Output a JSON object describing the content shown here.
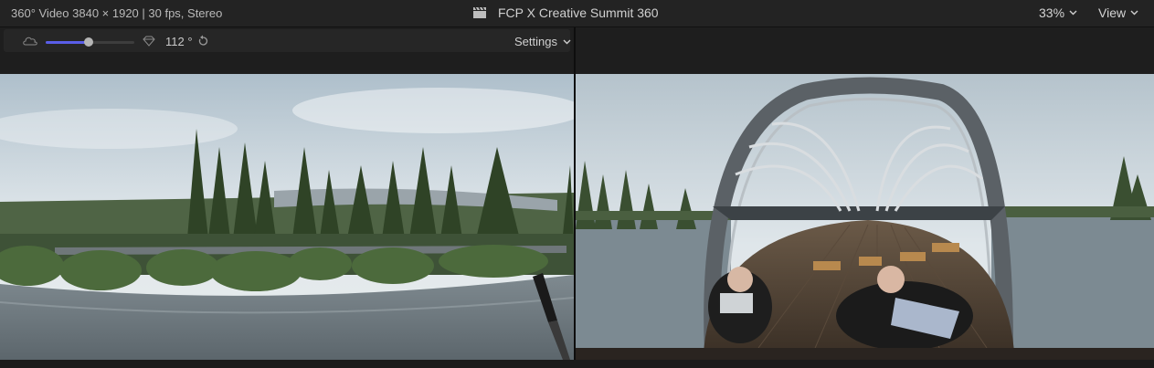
{
  "header": {
    "video_info": "360° Video 3840 × 1920 | 30 fps, Stereo",
    "project_title": "FCP X Creative Summit 360",
    "zoom_level": "33%",
    "view_label": "View"
  },
  "toolbar": {
    "angle_value": "112 °",
    "settings_label": "Settings",
    "slider_level": 0.48
  },
  "colors": {
    "accent": "#5a5ee8",
    "background": "#1b1b1b",
    "panel": "#232323"
  },
  "icons": {
    "title": "clapperboard-icon",
    "left_control": "cloud-icon",
    "right_control": "gem-icon",
    "reset": "reset-icon"
  }
}
